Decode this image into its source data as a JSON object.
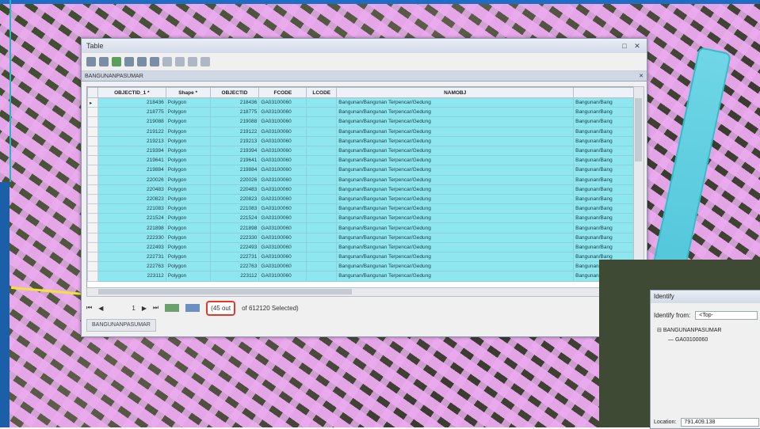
{
  "table_window": {
    "title": "Table",
    "layer_tab": "BANGUNANPASUMAR",
    "columns": [
      "OBJECTID_1 *",
      "Shape *",
      "OBJECTID",
      "FCODE",
      "LCODE",
      "NAMOBJ",
      ""
    ],
    "rows": [
      [
        "218436",
        "Polygon",
        "218436",
        "GA03100060",
        "",
        "Bangunan/Bangunan Terpencar/Gedung",
        "Bangunan/Bang"
      ],
      [
        "218775",
        "Polygon",
        "218775",
        "GA03100060",
        "",
        "Bangunan/Bangunan Terpencar/Gedung",
        "Bangunan/Bang"
      ],
      [
        "219088",
        "Polygon",
        "219088",
        "GA03100060",
        "",
        "Bangunan/Bangunan Terpencar/Gedung",
        "Bangunan/Bang"
      ],
      [
        "219122",
        "Polygon",
        "219122",
        "GA03100060",
        "",
        "Bangunan/Bangunan Terpencar/Gedung",
        "Bangunan/Bang"
      ],
      [
        "219213",
        "Polygon",
        "219213",
        "GA03100060",
        "",
        "Bangunan/Bangunan Terpencar/Gedung",
        "Bangunan/Bang"
      ],
      [
        "219394",
        "Polygon",
        "219394",
        "GA03100060",
        "",
        "Bangunan/Bangunan Terpencar/Gedung",
        "Bangunan/Bang"
      ],
      [
        "219641",
        "Polygon",
        "219641",
        "GA03100060",
        "",
        "Bangunan/Bangunan Terpencar/Gedung",
        "Bangunan/Bang"
      ],
      [
        "219884",
        "Polygon",
        "219884",
        "GA03100060",
        "",
        "Bangunan/Bangunan Terpencar/Gedung",
        "Bangunan/Bang"
      ],
      [
        "220026",
        "Polygon",
        "220026",
        "GA03100060",
        "",
        "Bangunan/Bangunan Terpencar/Gedung",
        "Bangunan/Bang"
      ],
      [
        "220483",
        "Polygon",
        "220483",
        "GA03100060",
        "",
        "Bangunan/Bangunan Terpencar/Gedung",
        "Bangunan/Bang"
      ],
      [
        "220823",
        "Polygon",
        "220823",
        "GA03100060",
        "",
        "Bangunan/Bangunan Terpencar/Gedung",
        "Bangunan/Bang"
      ],
      [
        "221083",
        "Polygon",
        "221083",
        "GA03100060",
        "",
        "Bangunan/Bangunan Terpencar/Gedung",
        "Bangunan/Bang"
      ],
      [
        "221524",
        "Polygon",
        "221524",
        "GA03100060",
        "",
        "Bangunan/Bangunan Terpencar/Gedung",
        "Bangunan/Bang"
      ],
      [
        "221898",
        "Polygon",
        "221898",
        "GA03100060",
        "",
        "Bangunan/Bangunan Terpencar/Gedung",
        "Bangunan/Bang"
      ],
      [
        "222330",
        "Polygon",
        "222330",
        "GA03100060",
        "",
        "Bangunan/Bangunan Terpencar/Gedung",
        "Bangunan/Bang"
      ],
      [
        "222493",
        "Polygon",
        "222493",
        "GA03100060",
        "",
        "Bangunan/Bangunan Terpencar/Gedung",
        "Bangunan/Bang"
      ],
      [
        "222731",
        "Polygon",
        "222731",
        "GA03100060",
        "",
        "Bangunan/Bangunan Terpencar/Gedung",
        "Bangunan/Bang"
      ],
      [
        "222763",
        "Polygon",
        "222763",
        "GA03100060",
        "",
        "Bangunan/Bangunan Terpencar/Gedung",
        "Bangunan/Bang"
      ],
      [
        "223112",
        "Polygon",
        "223112",
        "GA03100060",
        "",
        "Bangunan/Bangunan Terpencar/Gedung",
        "Bangunan/Bang"
      ]
    ],
    "nav": {
      "record_number": "1",
      "selected_count": "(45 out",
      "selected_total": "of 612120 Selected)"
    },
    "bottom_tab": "BANGUNANPASUMAR"
  },
  "identify_window": {
    "title": "Identify",
    "identify_from_label": "Identify from:",
    "identify_from_value": "<Top-",
    "tree_layer": "BANGUNANPASUMAR",
    "tree_child": "GA03100060",
    "location_label": "Location:",
    "location_value": "791,409.138"
  },
  "colors": {
    "selected_row": "#8ee6ee",
    "highlight_box": "#e03a2a",
    "building_fill": "#eeaaf0"
  }
}
